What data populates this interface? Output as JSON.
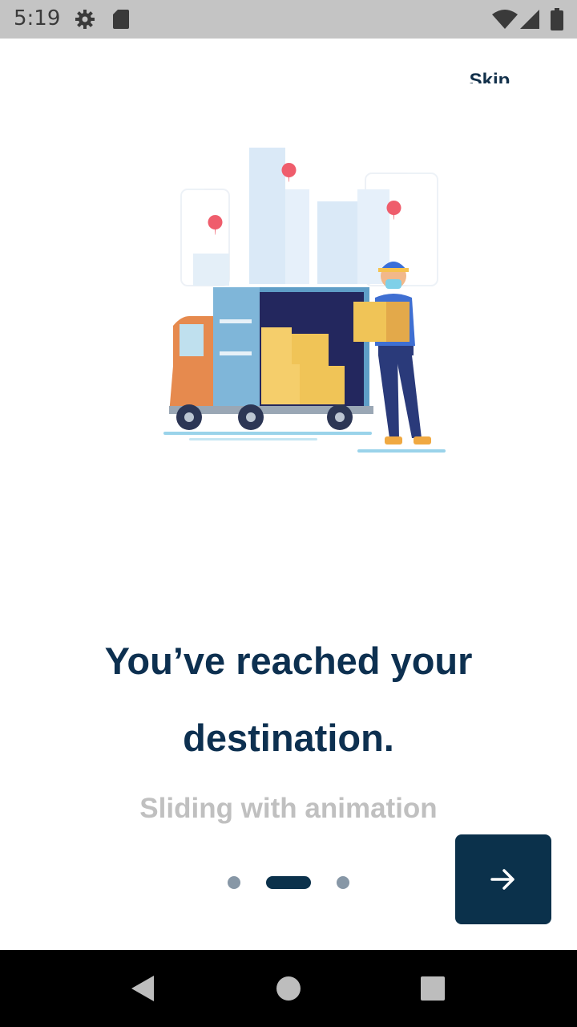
{
  "status_bar": {
    "time": "5:19",
    "icons": [
      "gear-icon",
      "sd-card-icon",
      "wifi-icon",
      "signal-icon",
      "battery-icon"
    ]
  },
  "onboarding": {
    "skip_label": "Skip",
    "title_line1": "You’ve reached your",
    "title_line2": "destination.",
    "subtitle": "Sliding with animation",
    "pager": {
      "page_count": 3,
      "current_page": 2
    },
    "next_button_icon": "arrow-right-icon"
  },
  "navigation_bar": {
    "icons": [
      "back-icon",
      "home-icon",
      "recents-icon"
    ]
  },
  "colors": {
    "primary": "#0b314b",
    "title": "#0d3050",
    "subtitle": "#c0c0c0",
    "status_bar": "#c4c4c4",
    "dot_inactive": "#8797a6",
    "dot_active": "#0b314b"
  }
}
